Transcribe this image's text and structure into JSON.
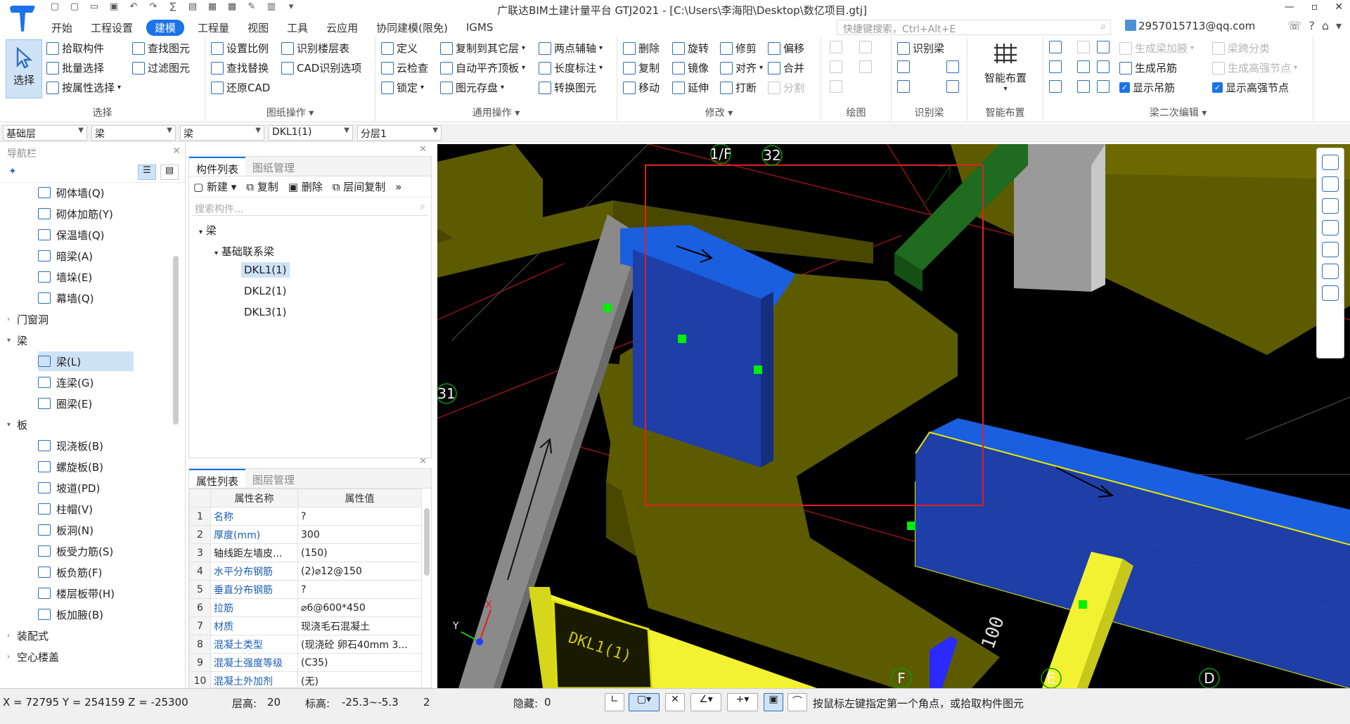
{
  "app": {
    "title": "广联达BIM土建计量平台 GTJ2021 - [C:\\Users\\李海阳\\Desktop\\数亿项目.gtj]",
    "window_buttons": [
      "—",
      "▫",
      "✕"
    ]
  },
  "menus": [
    "开始",
    "工程设置",
    "建模",
    "工程量",
    "视图",
    "工具",
    "云应用",
    "协同建模(限免)",
    "IGMS"
  ],
  "active_menu": "建模",
  "search": {
    "placeholder": "快捷键搜索，Ctrl+Alt+E"
  },
  "account": "2957015713@qq.com",
  "ribbon": {
    "select_group": {
      "big": "选择",
      "items": [
        "拾取构件",
        "批量选择",
        "按属性选择",
        "查找图元",
        "过滤图元"
      ],
      "label": "选择"
    },
    "drawing_group": {
      "items": [
        "设置比例",
        "识别楼层表",
        "查找替换",
        "CAD识别选项",
        "还原CAD"
      ],
      "label": "图纸操作"
    },
    "general_group": {
      "items": [
        "定义",
        "复制到其它层",
        "两点辅轴",
        "云检查",
        "自动平齐顶板",
        "长度标注",
        "锁定",
        "图元存盘",
        "转换图元"
      ],
      "label": "通用操作"
    },
    "modify_group": {
      "items": [
        "删除",
        "旋转",
        "修剪",
        "偏移",
        "复制",
        "镜像",
        "对齐",
        "合并",
        "移动",
        "延伸",
        "打断",
        "分割"
      ],
      "label": "修改"
    },
    "draw_group": {
      "label": "绘图"
    },
    "recog_group": {
      "items": [
        "识别梁"
      ],
      "label": "识别梁"
    },
    "smart_group": {
      "big": "智能布置",
      "label": "智能布置"
    },
    "beam2_group": {
      "items": [
        "生成梁加腋",
        "梁跨分类",
        "生成高强节点",
        "生成吊筋",
        "显示吊筋",
        "显示高强节点"
      ],
      "label": "梁二次编辑"
    }
  },
  "filters": [
    "基础层",
    "梁",
    "梁",
    "DKL1(1)",
    "分层1"
  ],
  "nav": {
    "title": "导航栏",
    "items": [
      {
        "label": "砌体墙(Q)",
        "type": "leaf"
      },
      {
        "label": "砌体加筋(Y)",
        "type": "leaf"
      },
      {
        "label": "保温墙(Q)",
        "type": "leaf"
      },
      {
        "label": "暗梁(A)",
        "type": "leaf"
      },
      {
        "label": "墙垛(E)",
        "type": "leaf"
      },
      {
        "label": "幕墙(Q)",
        "type": "leaf"
      },
      {
        "label": "门窗洞",
        "type": "group",
        "open": false
      },
      {
        "label": "梁",
        "type": "group",
        "open": true
      },
      {
        "label": "梁(L)",
        "type": "leaf",
        "selected": true
      },
      {
        "label": "连梁(G)",
        "type": "leaf"
      },
      {
        "label": "圈梁(E)",
        "type": "leaf"
      },
      {
        "label": "板",
        "type": "group",
        "open": true
      },
      {
        "label": "现浇板(B)",
        "type": "leaf"
      },
      {
        "label": "螺旋板(B)",
        "type": "leaf"
      },
      {
        "label": "坡道(PD)",
        "type": "leaf"
      },
      {
        "label": "柱帽(V)",
        "type": "leaf"
      },
      {
        "label": "板洞(N)",
        "type": "leaf"
      },
      {
        "label": "板受力筋(S)",
        "type": "leaf"
      },
      {
        "label": "板负筋(F)",
        "type": "leaf"
      },
      {
        "label": "楼层板带(H)",
        "type": "leaf"
      },
      {
        "label": "板加腋(B)",
        "type": "leaf"
      },
      {
        "label": "装配式",
        "type": "group",
        "open": false
      },
      {
        "label": "空心楼盖",
        "type": "group",
        "open": false
      }
    ]
  },
  "components": {
    "tabs": [
      "构件列表",
      "图纸管理"
    ],
    "toolbar": [
      "新建",
      "复制",
      "删除",
      "层间复制"
    ],
    "search_placeholder": "搜索构件...",
    "tree_root": "梁",
    "tree_group": "基础联系梁",
    "items": [
      "DKL1(1)",
      "DKL2(1)",
      "DKL3(1)"
    ],
    "selected": "DKL1(1)"
  },
  "properties": {
    "tabs": [
      "属性列表",
      "图层管理"
    ],
    "headers": [
      "属性名称",
      "属性值"
    ],
    "rows": [
      {
        "n": "1",
        "name": "名称",
        "value": "?",
        "blue": true
      },
      {
        "n": "2",
        "name": "厚度(mm)",
        "value": "300",
        "blue": true
      },
      {
        "n": "3",
        "name": "轴线距左墙皮...",
        "value": "(150)",
        "blue": false
      },
      {
        "n": "4",
        "name": "水平分布钢筋",
        "value": "(2)⌀12@150",
        "blue": true
      },
      {
        "n": "5",
        "name": "垂直分布钢筋",
        "value": "?",
        "blue": true
      },
      {
        "n": "6",
        "name": "拉筋",
        "value": "⌀6@600*450",
        "blue": true
      },
      {
        "n": "7",
        "name": "材质",
        "value": "现浇毛石混凝土",
        "blue": true
      },
      {
        "n": "8",
        "name": "混凝土类型",
        "value": "(现浇砼 卵石40mm 3...",
        "blue": true
      },
      {
        "n": "9",
        "name": "混凝土强度等级",
        "value": "(C35)",
        "blue": true
      },
      {
        "n": "10",
        "name": "混凝土外加剂",
        "value": "(无)",
        "blue": true
      }
    ]
  },
  "viewport": {
    "axis_labels": [
      "1/F",
      "32",
      "31",
      "F",
      "E",
      "D"
    ],
    "dim_text": "100",
    "beam_text": "DKL1(1)"
  },
  "status": {
    "coords": "X = 72795 Y = 254159 Z = -25300",
    "floor_height_label": "层高:",
    "floor_height": "20",
    "elevation_label": "标高:",
    "elevation": "-25.3~-5.3",
    "count": "2",
    "hidden_label": "隐藏:",
    "hidden": "0",
    "hint": "按鼠标左键指定第一个角点，或拾取构件图元"
  }
}
